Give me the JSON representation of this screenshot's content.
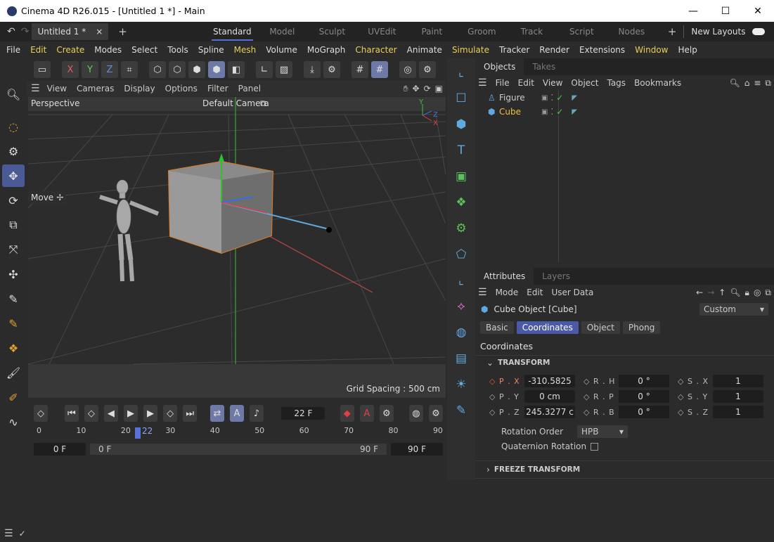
{
  "window": {
    "title": "Cinema 4D R26.015 - [Untitled 1 *] - Main",
    "minimize": "—",
    "maximize": "☐",
    "close": "✕"
  },
  "tabs": {
    "doc": "Untitled 1 *",
    "doc_close": "×",
    "add": "+",
    "layouts": [
      "Standard",
      "Model",
      "Sculpt",
      "UVEdit",
      "Paint",
      "Groom",
      "Track",
      "Script",
      "Nodes"
    ],
    "new_layouts": "New Layouts"
  },
  "menu": [
    "File",
    "Edit",
    "Create",
    "Modes",
    "Select",
    "Tools",
    "Spline",
    "Mesh",
    "Volume",
    "MoGraph",
    "Character",
    "Animate",
    "Simulate",
    "Tracker",
    "Render",
    "Extensions",
    "Window",
    "Help"
  ],
  "toolbar": {
    "x": "X",
    "y": "Y",
    "z": "Z"
  },
  "viewport": {
    "menu": [
      "View",
      "Cameras",
      "Display",
      "Options",
      "Filter",
      "Panel"
    ],
    "name": "Perspective",
    "camera": "Default Camera",
    "tool_label": "Move",
    "grid_spacing": "Grid Spacing : 500 cm",
    "axis_y": "Y",
    "axis_z": "Z",
    "axis_x": "X"
  },
  "timeline": {
    "current_frame": "22 F",
    "ticks": [
      "0",
      "10",
      "20",
      "30",
      "40",
      "50",
      "60",
      "70",
      "80",
      "90"
    ],
    "playhead_label": "22",
    "start": "0 F",
    "range_start": "0 F",
    "range_end": "90 F",
    "end": "90 F"
  },
  "objects": {
    "tabs": [
      "Objects",
      "Takes"
    ],
    "menu": [
      "File",
      "Edit",
      "View",
      "Object",
      "Tags",
      "Bookmarks"
    ],
    "items": [
      {
        "name": "Figure",
        "selected": false
      },
      {
        "name": "Cube",
        "selected": true
      }
    ]
  },
  "attributes": {
    "tabs": [
      "Attributes",
      "Layers"
    ],
    "menu": [
      "Mode",
      "Edit",
      "User Data"
    ],
    "object_title": "Cube Object [Cube]",
    "preset": "Custom",
    "subtabs": [
      "Basic",
      "Coordinates",
      "Object",
      "Phong"
    ],
    "section_title": "Coordinates",
    "transform": "TRANSFORM",
    "rows": [
      {
        "p_label": "P . X",
        "p_val": "-310.5825",
        "r_label": "R . H",
        "r_val": "0 °",
        "s_label": "S . X",
        "s_val": "1"
      },
      {
        "p_label": "P . Y",
        "p_val": "0 cm",
        "r_label": "R . P",
        "r_val": "0 °",
        "s_label": "S . Y",
        "s_val": "1"
      },
      {
        "p_label": "P . Z",
        "p_val": "245.3277 c",
        "r_label": "R . B",
        "r_val": "0 °",
        "s_label": "S . Z",
        "s_val": "1"
      }
    ],
    "rotation_order_label": "Rotation Order",
    "rotation_order": "HPB",
    "quaternion_label": "Quaternion Rotation",
    "freeze": "FREEZE TRANSFORM"
  },
  "colors": {
    "accent": "#5b6fd8",
    "menu_highlight": "#e8d05a",
    "selected_object": "#f0c040"
  }
}
